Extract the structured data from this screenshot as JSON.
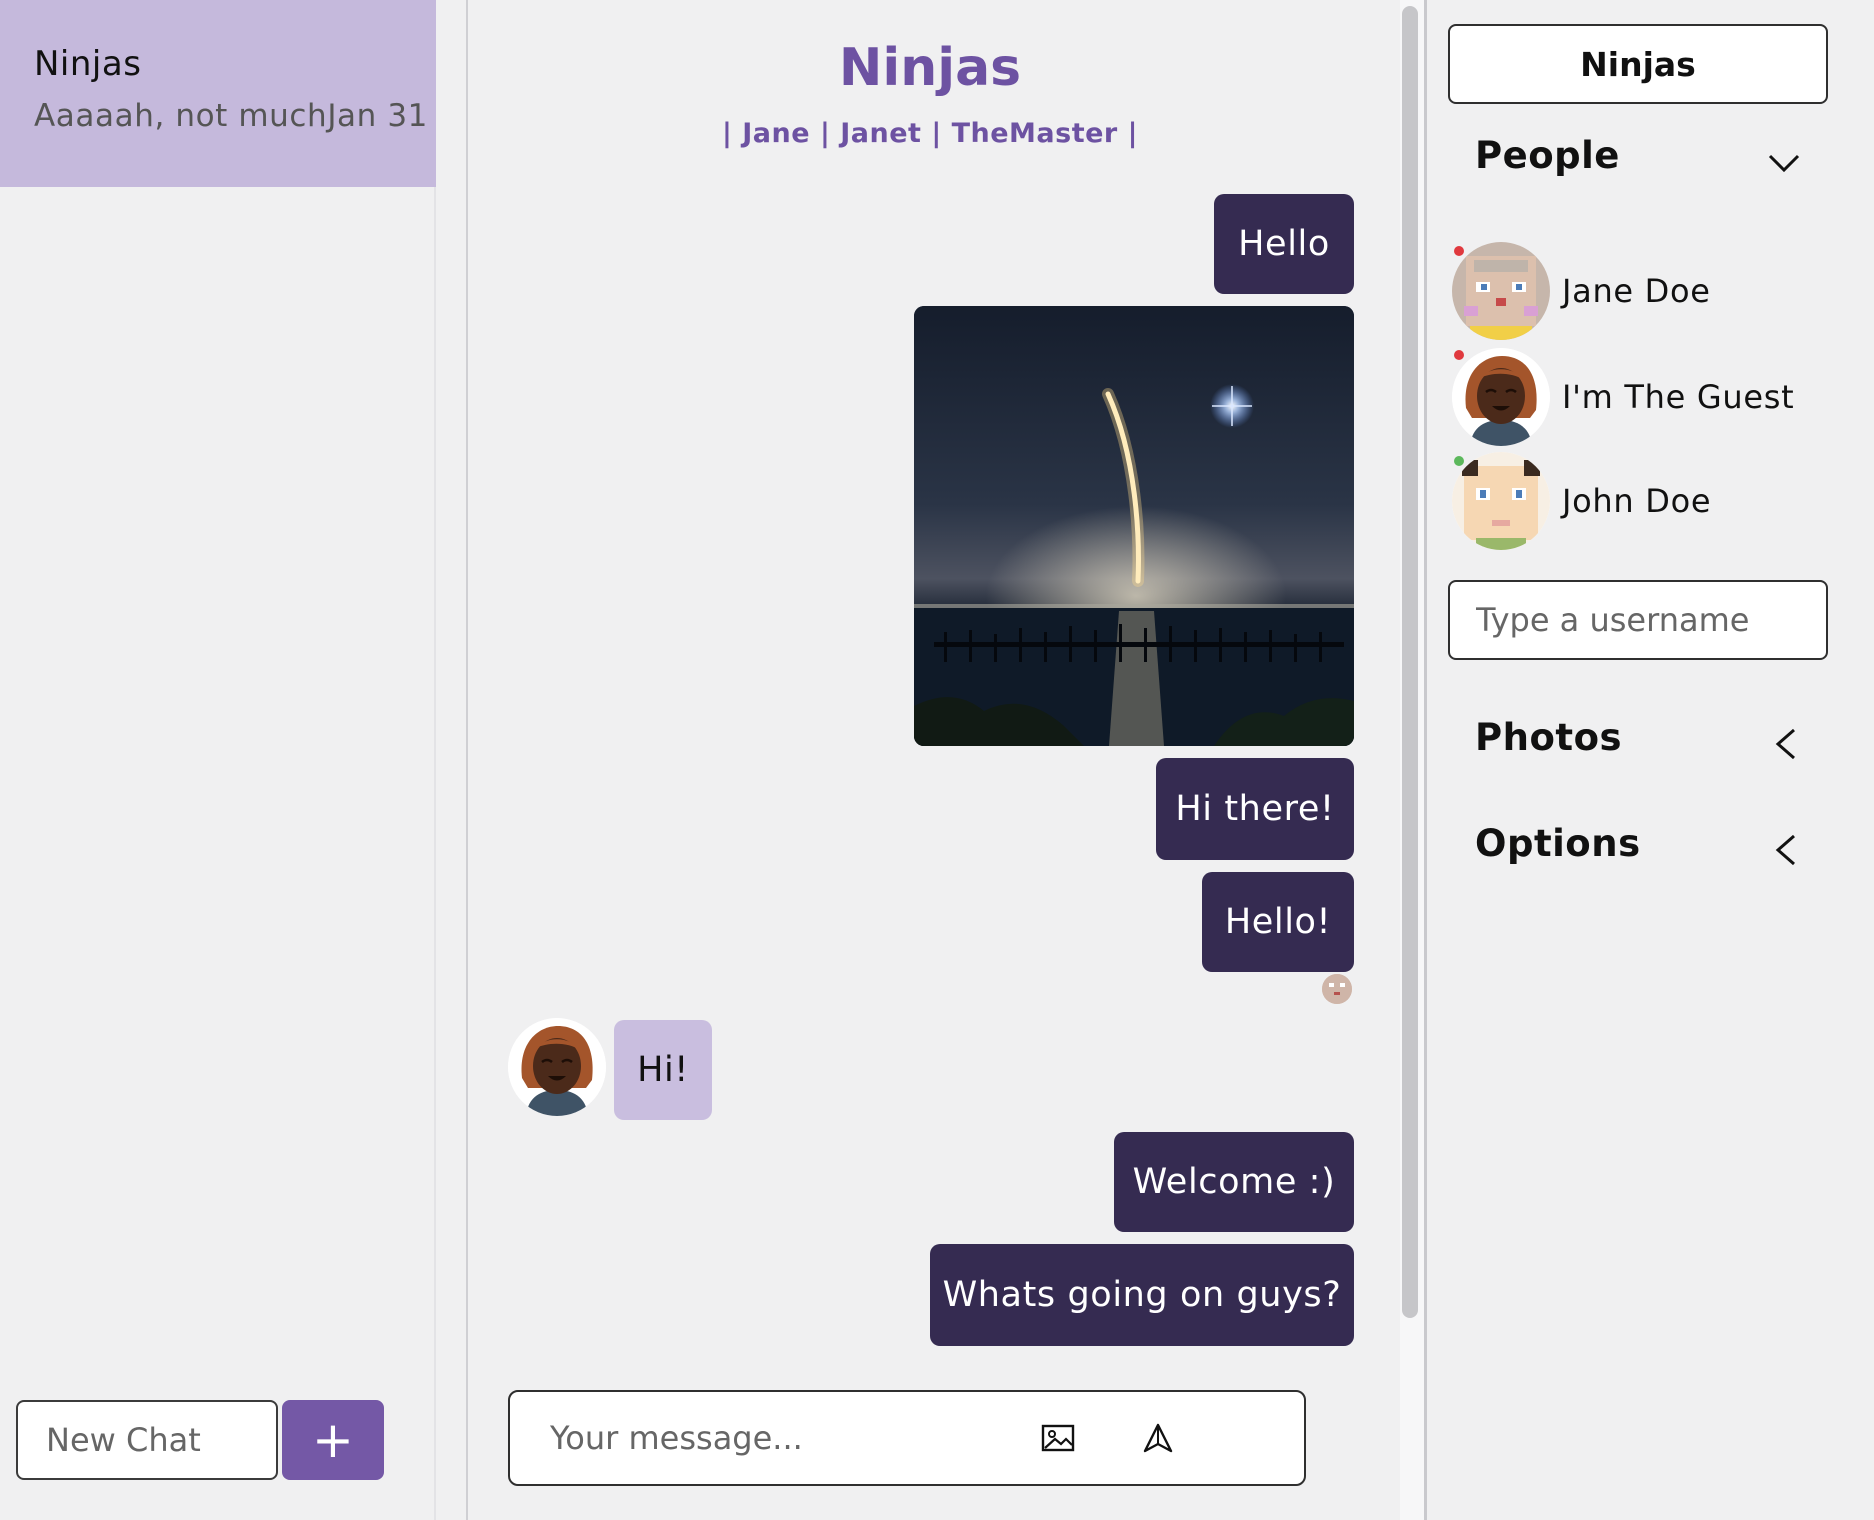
{
  "sidebar": {
    "chats": [
      {
        "name": "Ninjas",
        "last_message": "Aaaaah, not much",
        "date": "Jan 31"
      }
    ],
    "new_chat_placeholder": "New Chat",
    "add_label": "+"
  },
  "chat": {
    "title": "Ninjas",
    "members": "| Jane | Janet | TheMaster |",
    "messages": [
      {
        "type": "text",
        "direction": "out",
        "text": "Hello"
      },
      {
        "type": "image",
        "direction": "out",
        "alt": "rocket launch night photo"
      },
      {
        "type": "text",
        "direction": "out",
        "text": "Hi there!"
      },
      {
        "type": "text",
        "direction": "out",
        "text": "Hello!"
      },
      {
        "type": "text",
        "direction": "in",
        "text": "Hi!"
      },
      {
        "type": "text",
        "direction": "out",
        "text": "Welcome :)"
      },
      {
        "type": "text",
        "direction": "out",
        "text": "Whats going on guys?"
      }
    ],
    "input_placeholder": "Your message..."
  },
  "panel": {
    "chat_name": "Ninjas",
    "people_label": "People",
    "people": [
      {
        "name": "Jane Doe",
        "status_color": "#e0393e"
      },
      {
        "name": "I'm The Guest",
        "status_color": "#e0393e"
      },
      {
        "name": "John Doe",
        "status_color": "#5cb85c"
      }
    ],
    "username_placeholder": "Type a username",
    "photos_label": "Photos",
    "options_label": "Options"
  },
  "icons": {
    "image_upload": "image-icon",
    "send": "send-icon",
    "people_toggle": "chevron-down-icon",
    "photos_toggle": "chevron-left-icon",
    "options_toggle": "chevron-left-icon"
  },
  "colors": {
    "accent": "#7458a6",
    "title": "#6d52a2",
    "outgoing_bubble": "#352b51",
    "incoming_bubble": "#c9bedf",
    "active_chat": "#c5b9dc"
  }
}
